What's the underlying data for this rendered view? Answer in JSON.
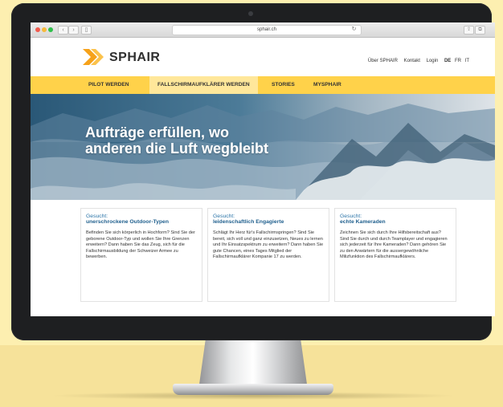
{
  "browser": {
    "url": "sphair.ch",
    "back_icon": "chevron-left-icon",
    "forward_icon": "chevron-right-icon"
  },
  "site": {
    "logo_text": "SPHAIR",
    "util_nav": [
      "Über SPHAIR",
      "Kontakt",
      "Login"
    ],
    "languages": [
      "DE",
      "FR",
      "IT"
    ],
    "active_language": "DE"
  },
  "main_nav": {
    "items": [
      "PILOT WERDEN",
      "FALLSCHIRMAUFKLÄRER WERDEN",
      "STORIES",
      "MYSPHAIR"
    ],
    "active_index": 1
  },
  "hero": {
    "title_line1": "Aufträge erfüllen, wo",
    "title_line2": "anderen die Luft wegbleibt"
  },
  "cards": [
    {
      "label": "Gesucht:",
      "title": "unerschrockene Outdoor-Typen",
      "body": "Befinden Sie sich körperlich in Hochform? Sind Sie der geborene Outdoor-Typ und wollen Sie Ihre Grenzen erweitern? Dann haben Sie das Zeug, sich für die Fallschirmausbildung der Schweizer Armee zu bewerben."
    },
    {
      "label": "Gesucht:",
      "title": "leidenschaftlich Engagierte",
      "body": "Schlägt Ihr Herz für's Fallschirmspringen? Sind Sie bereit, sich voll und ganz einzusetzen, Neues zu lernen und Ihr Einsatzspektrum zu erweitern? Dann haben Sie gute Chancen, eines Tages Mitglied der Fallschirmaufklärer Kompanie 17 zu werden."
    },
    {
      "label": "Gesucht:",
      "title": "echte Kameraden",
      "body": "Zeichnen Sie sich durch Ihre Hilfsbereitschaft aus? Sind Sie durch und durch Teamplayer und engagieren sich jederzeit für Ihre Kameraden? Dann gehören Sie zu den Anwärtern für die aussergewöhnliche Milizfunktion des Fallschirmaufklärers."
    }
  ],
  "colors": {
    "nav_yellow": "#ffd24a",
    "nav_active": "#ffe79a",
    "link_blue": "#2b74a8",
    "logo_orange": "#f6a21a",
    "background": "#fdefb0"
  }
}
